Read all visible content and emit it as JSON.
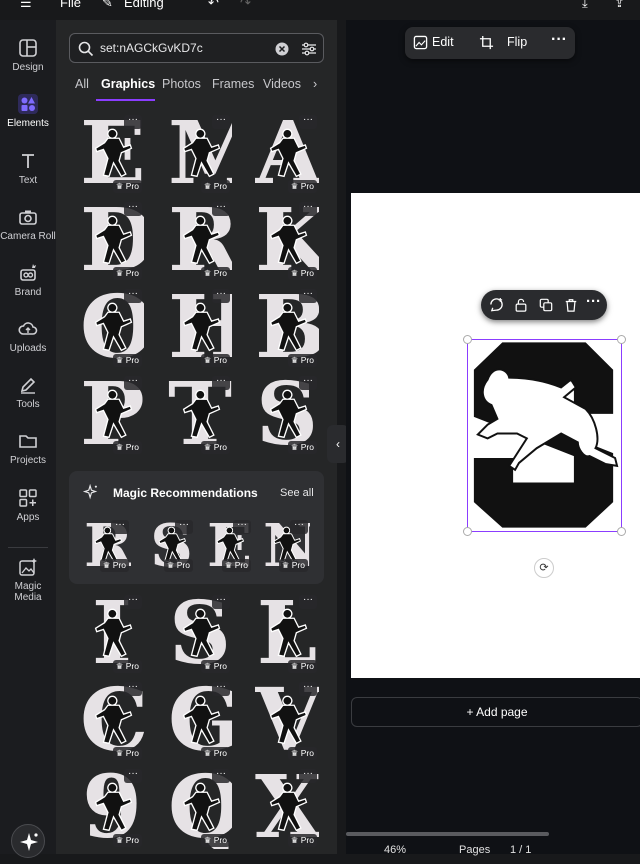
{
  "topbar": {
    "file_label": "File",
    "mode_label": "Editing"
  },
  "rail": {
    "items": [
      {
        "label": "Design",
        "icon": "layout-icon"
      },
      {
        "label": "Elements",
        "icon": "elements-icon"
      },
      {
        "label": "Text",
        "icon": "text-icon"
      },
      {
        "label": "Camera Roll",
        "icon": "camera-icon"
      },
      {
        "label": "Brand",
        "icon": "brand-icon"
      },
      {
        "label": "Uploads",
        "icon": "upload-cloud-icon"
      },
      {
        "label": "Tools",
        "icon": "pen-icon"
      },
      {
        "label": "Projects",
        "icon": "folder-icon"
      },
      {
        "label": "Apps",
        "icon": "apps-icon"
      },
      {
        "label": "Magic Media",
        "icon": "magic-media-icon"
      }
    ]
  },
  "search": {
    "query": "set:nAGCkGvKD7c"
  },
  "tabs": [
    "All",
    "Graphics",
    "Photos",
    "Frames",
    "Videos"
  ],
  "active_tab": "Graphics",
  "grid_top": [
    "E",
    "M",
    "A",
    "D",
    "R",
    "K",
    "O",
    "H",
    "B",
    "P",
    "T",
    "S"
  ],
  "magic": {
    "title": "Magic Recommendations",
    "see_all": "See all",
    "letters": [
      "R",
      "S",
      "E",
      "N"
    ]
  },
  "grid_bottom": [
    "I",
    "S",
    "L",
    "C",
    "G",
    "V",
    "9",
    "Q",
    "X"
  ],
  "pro_label": "Pro",
  "canvas": {
    "edit_label": "Edit",
    "flip_label": "Flip",
    "selected_letter": "S",
    "add_page_label": "+ Add page",
    "zoom": "46%",
    "pages_label": "Pages",
    "page_count": "1 / 1"
  },
  "colors": {
    "accent": "#8b3dff",
    "panel": "#252627",
    "canvas_bg": "#0f1115"
  }
}
